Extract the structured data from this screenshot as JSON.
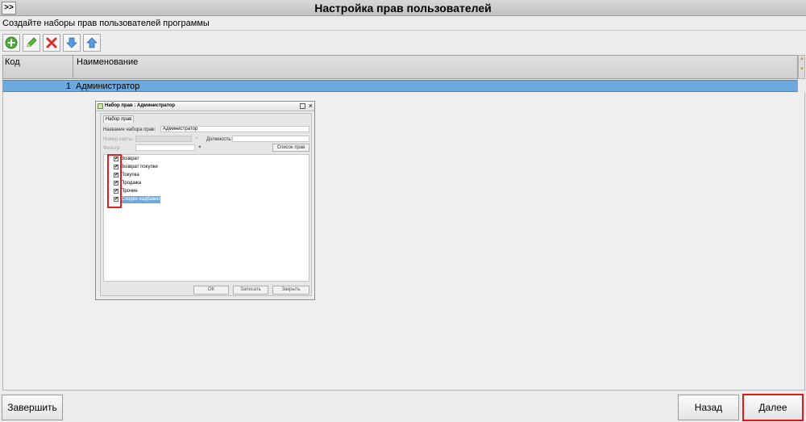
{
  "window": {
    "title": "Настройка прав пользователей",
    "expand_label": ">>"
  },
  "subtitle": "Создайте наборы прав пользователей программы",
  "toolbar": {
    "icons": [
      "add-icon",
      "edit-icon",
      "delete-icon",
      "move-down-icon",
      "move-up-icon"
    ]
  },
  "grid": {
    "headers": {
      "code": "Код",
      "name": "Наименование"
    },
    "rows": [
      {
        "code": "1",
        "name": "Администратор"
      }
    ]
  },
  "dialog": {
    "title": "Набор прав : Администратор",
    "tab": "Набор прав",
    "name_label": "Название набора прав:",
    "name_value": "Администратор",
    "card_label": "Номер карты:",
    "position_label": "Должность:",
    "filter_label": "Фильтр:",
    "rights_list_button": "Список прав",
    "items": [
      "Возврат",
      "Возврат покупки",
      "Покупка",
      "Продажа",
      "Прочие",
      "Скидки надбавки"
    ],
    "ok_button": "ОК",
    "save_button": "Записать",
    "close_button": "Закрыть"
  },
  "footer": {
    "finish": "Завершить",
    "back": "Назад",
    "next": "Далее"
  },
  "colors": {
    "selection": "#6ea9dd",
    "highlight": "#e01818"
  }
}
